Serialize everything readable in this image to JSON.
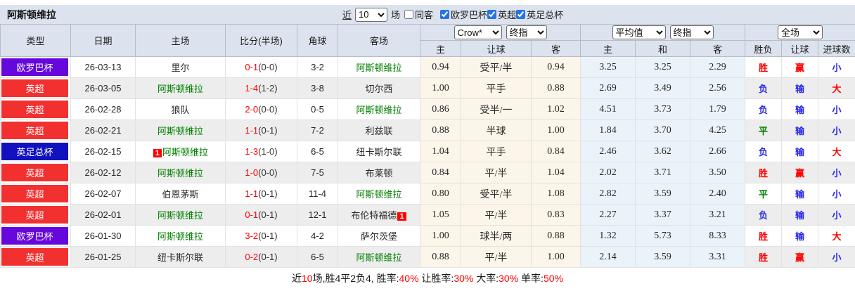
{
  "title": "阿斯顿维拉",
  "controls": {
    "recent_label": "近",
    "recent_value": "10",
    "matches_label": "场",
    "same_away_label": "同客",
    "same_away_checked": false,
    "filters": [
      {
        "label": "欧罗巴杯",
        "checked": true
      },
      {
        "label": "英超",
        "checked": true
      },
      {
        "label": "英足总杯",
        "checked": true
      }
    ]
  },
  "selects": {
    "bookmaker": "Crow*",
    "asian_stage": "终指",
    "average": "平均值",
    "euro_stage": "终指",
    "scope": "全场"
  },
  "colors": {
    "league_purple": "#6607dc",
    "league_red": "#f23030",
    "league_blue": "#1111bf",
    "team_highlight": "#008000",
    "score_red": "#ff0000",
    "result_red": "#ff0000",
    "result_blue": "#2626ee",
    "result_green": "#008000",
    "header_band": "#dce3ee",
    "asian_col_bg": "#fbf6e9",
    "euro_col_bg": "#e9f3f9"
  },
  "table": {
    "left_headers": [
      "类型",
      "日期",
      "主场",
      "比分(半场)",
      "角球",
      "客场"
    ],
    "asian_headers": [
      "主",
      "让球",
      "客"
    ],
    "euro_headers": [
      "主",
      "和",
      "客"
    ],
    "result_headers": [
      "胜负",
      "让球",
      "进球数"
    ],
    "rows": [
      {
        "league": "欧罗巴杯",
        "league_color": "purple",
        "date": "26-03-13",
        "home": {
          "name": "里尔",
          "highlight": false
        },
        "score": "0-1",
        "half": "(0-0)",
        "corner": "3-2",
        "away": {
          "name": "阿斯顿维拉",
          "highlight": true
        },
        "asian": [
          "0.94",
          "受平/半",
          "0.94"
        ],
        "euro": [
          "3.25",
          "3.25",
          "2.29"
        ],
        "results": [
          {
            "text": "胜",
            "color": "red"
          },
          {
            "text": "赢",
            "color": "red"
          },
          {
            "text": "小",
            "color": "blue"
          }
        ]
      },
      {
        "league": "英超",
        "league_color": "red",
        "date": "26-03-05",
        "home": {
          "name": "阿斯顿维拉",
          "highlight": true
        },
        "score": "1-4",
        "half": "(1-2)",
        "corner": "3-8",
        "away": {
          "name": "切尔西",
          "highlight": false
        },
        "asian": [
          "1.00",
          "平手",
          "0.88"
        ],
        "euro": [
          "2.69",
          "3.49",
          "2.56"
        ],
        "results": [
          {
            "text": "负",
            "color": "blue"
          },
          {
            "text": "输",
            "color": "blue"
          },
          {
            "text": "大",
            "color": "red"
          }
        ]
      },
      {
        "league": "英超",
        "league_color": "red",
        "date": "26-02-28",
        "home": {
          "name": "狼队",
          "highlight": false
        },
        "score": "2-0",
        "half": "(0-0)",
        "corner": "0-5",
        "away": {
          "name": "阿斯顿维拉",
          "highlight": true
        },
        "asian": [
          "0.86",
          "受半/一",
          "1.02"
        ],
        "euro": [
          "4.51",
          "3.73",
          "1.79"
        ],
        "results": [
          {
            "text": "负",
            "color": "blue"
          },
          {
            "text": "输",
            "color": "blue"
          },
          {
            "text": "小",
            "color": "blue"
          }
        ]
      },
      {
        "league": "英超",
        "league_color": "red",
        "date": "26-02-21",
        "home": {
          "name": "阿斯顿维拉",
          "highlight": true
        },
        "score": "1-1",
        "half": "(0-1)",
        "corner": "7-2",
        "away": {
          "name": "利兹联",
          "highlight": false
        },
        "asian": [
          "0.88",
          "半球",
          "1.00"
        ],
        "euro": [
          "1.84",
          "3.70",
          "4.25"
        ],
        "results": [
          {
            "text": "平",
            "color": "green"
          },
          {
            "text": "输",
            "color": "blue"
          },
          {
            "text": "小",
            "color": "blue"
          }
        ]
      },
      {
        "league": "英足总杯",
        "league_color": "blue",
        "date": "26-02-15",
        "home": {
          "name": "阿斯顿维拉",
          "highlight": true,
          "redcard_before": true
        },
        "score": "1-3",
        "half": "(1-0)",
        "corner": "6-5",
        "away": {
          "name": "纽卡斯尔联",
          "highlight": false
        },
        "asian": [
          "1.04",
          "平手",
          "0.84"
        ],
        "euro": [
          "2.46",
          "3.62",
          "2.66"
        ],
        "results": [
          {
            "text": "负",
            "color": "blue"
          },
          {
            "text": "输",
            "color": "blue"
          },
          {
            "text": "大",
            "color": "red"
          }
        ]
      },
      {
        "league": "英超",
        "league_color": "red",
        "date": "26-02-12",
        "home": {
          "name": "阿斯顿维拉",
          "highlight": true
        },
        "score": "1-0",
        "half": "(0-0)",
        "corner": "7-5",
        "away": {
          "name": "布莱顿",
          "highlight": false
        },
        "asian": [
          "0.84",
          "平/半",
          "1.04"
        ],
        "euro": [
          "2.02",
          "3.71",
          "3.50"
        ],
        "results": [
          {
            "text": "胜",
            "color": "red"
          },
          {
            "text": "赢",
            "color": "red"
          },
          {
            "text": "小",
            "color": "blue"
          }
        ]
      },
      {
        "league": "英超",
        "league_color": "red",
        "date": "26-02-07",
        "home": {
          "name": "伯恩茅斯",
          "highlight": false
        },
        "score": "1-1",
        "half": "(0-1)",
        "corner": "11-4",
        "away": {
          "name": "阿斯顿维拉",
          "highlight": true
        },
        "asian": [
          "0.80",
          "受平/半",
          "1.08"
        ],
        "euro": [
          "2.82",
          "3.59",
          "2.40"
        ],
        "results": [
          {
            "text": "平",
            "color": "green"
          },
          {
            "text": "输",
            "color": "blue"
          },
          {
            "text": "小",
            "color": "blue"
          }
        ]
      },
      {
        "league": "英超",
        "league_color": "red",
        "date": "26-02-01",
        "home": {
          "name": "阿斯顿维拉",
          "highlight": true
        },
        "score": "0-1",
        "half": "(0-1)",
        "corner": "12-1",
        "away": {
          "name": "布伦特福德",
          "highlight": false,
          "redcard_after": true
        },
        "asian": [
          "1.05",
          "平/半",
          "0.83"
        ],
        "euro": [
          "2.27",
          "3.37",
          "3.21"
        ],
        "results": [
          {
            "text": "负",
            "color": "blue"
          },
          {
            "text": "输",
            "color": "blue"
          },
          {
            "text": "小",
            "color": "blue"
          }
        ]
      },
      {
        "league": "欧罗巴杯",
        "league_color": "purple",
        "date": "26-01-30",
        "home": {
          "name": "阿斯顿维拉",
          "highlight": true
        },
        "score": "3-2",
        "half": "(0-1)",
        "corner": "4-2",
        "away": {
          "name": "萨尔茨堡",
          "highlight": false
        },
        "asian": [
          "1.00",
          "球半/两",
          "0.88"
        ],
        "euro": [
          "1.32",
          "5.73",
          "8.33"
        ],
        "results": [
          {
            "text": "胜",
            "color": "red"
          },
          {
            "text": "输",
            "color": "blue"
          },
          {
            "text": "大",
            "color": "red"
          }
        ]
      },
      {
        "league": "英超",
        "league_color": "red",
        "date": "26-01-25",
        "home": {
          "name": "纽卡斯尔联",
          "highlight": false
        },
        "score": "0-2",
        "half": "(0-1)",
        "corner": "6-5",
        "away": {
          "name": "阿斯顿维拉",
          "highlight": true
        },
        "asian": [
          "0.88",
          "平/半",
          "1.00"
        ],
        "euro": [
          "2.14",
          "3.59",
          "3.31"
        ],
        "results": [
          {
            "text": "胜",
            "color": "red"
          },
          {
            "text": "赢",
            "color": "red"
          },
          {
            "text": "小",
            "color": "blue"
          }
        ]
      }
    ]
  },
  "footer": {
    "segments": [
      {
        "text": "近",
        "red": false
      },
      {
        "text": "10",
        "red": true
      },
      {
        "text": "场,胜4平2负4, 胜率:",
        "red": false
      },
      {
        "text": "40%",
        "red": true
      },
      {
        "text": " 让胜率:",
        "red": false
      },
      {
        "text": "30%",
        "red": true
      },
      {
        "text": " 大率:",
        "red": false
      },
      {
        "text": "30%",
        "red": true
      },
      {
        "text": " 单率:",
        "red": false
      },
      {
        "text": "50%",
        "red": true
      }
    ]
  }
}
